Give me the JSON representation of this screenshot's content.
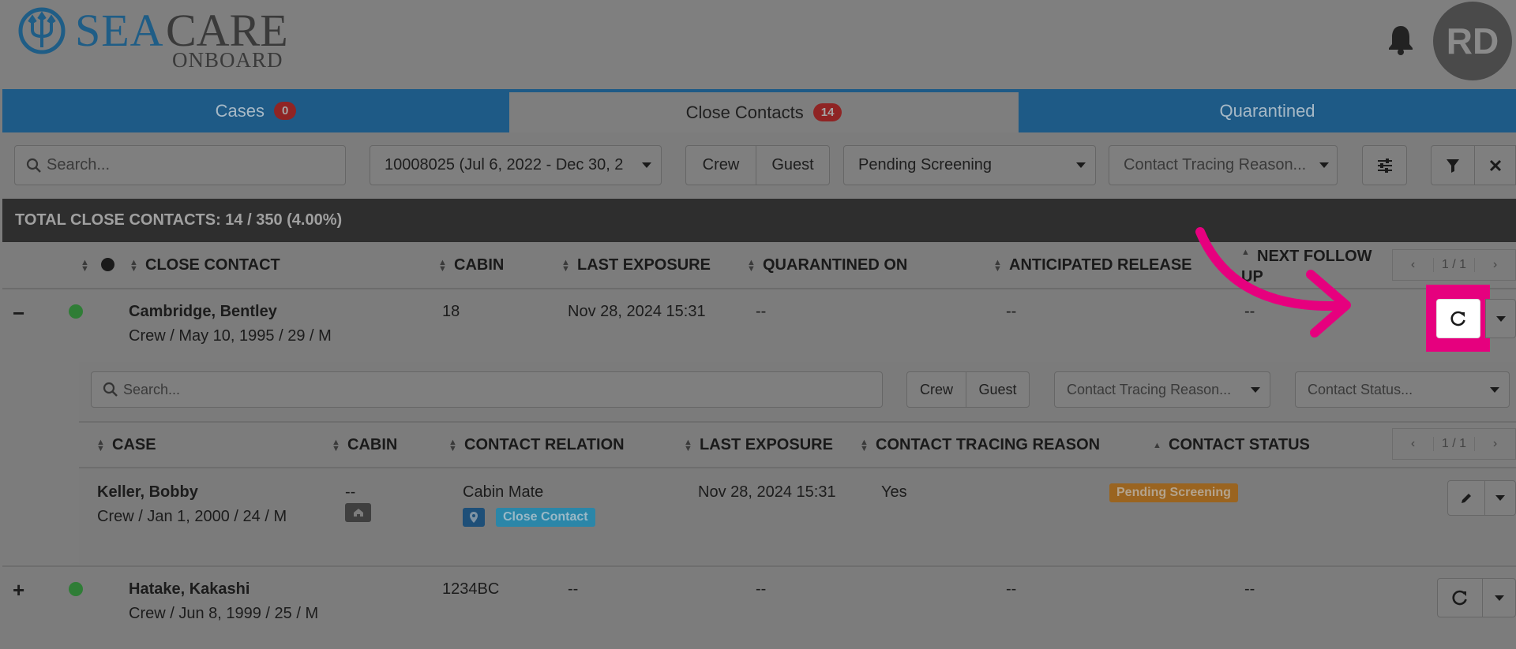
{
  "app": {
    "logo_sea": "SEA",
    "logo_care": "CARE",
    "logo_onboard": "ONBOARD",
    "user_initials": "RD"
  },
  "tabs": [
    {
      "label": "Cases",
      "count": "0"
    },
    {
      "label": "Close Contacts",
      "count": "14"
    },
    {
      "label": "Quarantined"
    }
  ],
  "filters": {
    "search_placeholder": "Search...",
    "voyage_value": "10008025 (Jul 6, 2022 - Dec 30, 2",
    "crew_label": "Crew",
    "guest_label": "Guest",
    "status_value": "Pending Screening",
    "reason_placeholder": "Contact Tracing Reason..."
  },
  "summary": {
    "total_label": "TOTAL CLOSE CONTACTS: 14 / 350 (4.00%)"
  },
  "table": {
    "headers": [
      "CLOSE CONTACT",
      "CABIN",
      "LAST EXPOSURE",
      "QUARANTINED ON",
      "ANTICIPATED RELEASE",
      "NEXT FOLLOW UP"
    ],
    "next_follow_up_line1": "NEXT FOLLOW",
    "next_follow_up_line2": "UP",
    "pager": "1 / 1",
    "rows": [
      {
        "toggle": "−",
        "name": "Cambridge, Bentley",
        "details": "Crew / May 10, 1995 / 29 / M",
        "cabin": "18",
        "last_exposure": "Nov 28, 2024 15:31",
        "quarantined_on": "--",
        "anticipated_release": "--",
        "next_follow_up": "--"
      },
      {
        "toggle": "+",
        "name": "Hatake, Kakashi",
        "details": "Crew / Jun 8, 1999 / 25 / M",
        "cabin": "1234BC",
        "last_exposure": "--",
        "quarantined_on": "--",
        "anticipated_release": "--",
        "next_follow_up": "--"
      }
    ]
  },
  "subtable": {
    "search_placeholder": "Search...",
    "crew_label": "Crew",
    "guest_label": "Guest",
    "reason_placeholder": "Contact Tracing Reason...",
    "status_placeholder": "Contact Status...",
    "headers": [
      "CASE",
      "CABIN",
      "CONTACT RELATION",
      "LAST EXPOSURE",
      "CONTACT TRACING REASON",
      "CONTACT STATUS"
    ],
    "pager": "1 / 1",
    "rows": [
      {
        "name": "Keller, Bobby",
        "details": "Crew / Jan 1, 2000 / 24 / M",
        "cabin": "--",
        "relation": "Cabin Mate",
        "relation_tag": "Close Contact",
        "last_exposure": "Nov 28, 2024 15:31",
        "reason": "Yes",
        "status": "Pending Screening"
      }
    ]
  },
  "colors": {
    "highlight": "#e6007e",
    "brand_blue": "#1e5a86"
  }
}
